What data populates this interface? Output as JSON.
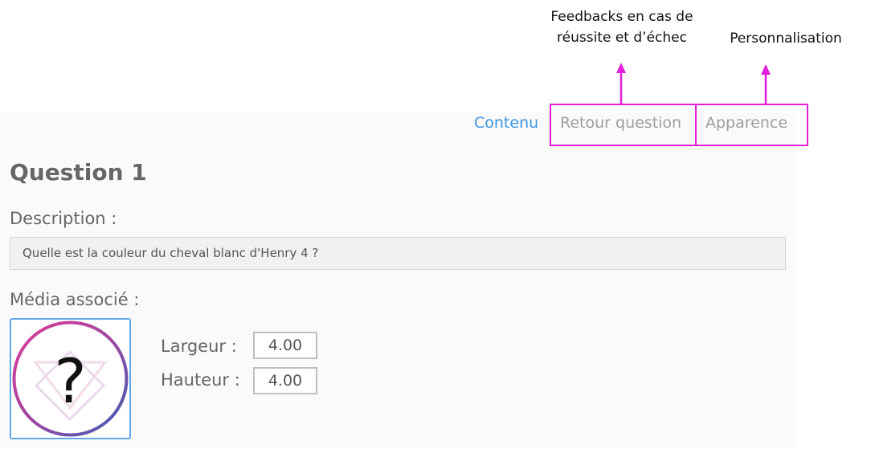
{
  "annotations": {
    "feedback_line1": "Feedbacks en cas de",
    "feedback_line2": "réussite et d’échec",
    "personalisation": "Personnalisation",
    "color": "#e11ed8"
  },
  "tabs": {
    "content": "Contenu",
    "feedback": "Retour question",
    "appearance": "Apparence",
    "active_color": "#3b97e3"
  },
  "question": {
    "title": "Question 1",
    "description_label": "Description :",
    "description_value": "Quelle est la couleur du cheval blanc d'Henry 4 ?",
    "media_label": "Média associé :",
    "media_icon": "question-mark-placeholder-icon",
    "width_label": "Largeur :",
    "width_value": "4.00",
    "height_label": "Hauteur :",
    "height_value": "4.00"
  }
}
